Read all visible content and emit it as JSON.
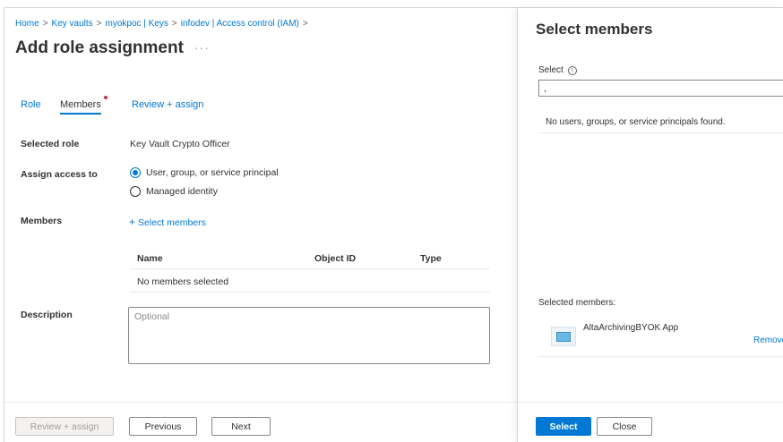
{
  "breadcrumb": {
    "items": [
      "Home",
      "Key vaults",
      "myokpoc | Keys",
      "infodev | Access control (IAM)"
    ],
    "trailing": ">"
  },
  "page": {
    "title": "Add role assignment",
    "more": "···"
  },
  "tabs": [
    {
      "label": "Role"
    },
    {
      "label": "Members"
    },
    {
      "label": "Review + assign"
    }
  ],
  "form": {
    "selected_role_label": "Selected role",
    "selected_role_value": "Key Vault Crypto Officer",
    "assign_access_label": "Assign access to",
    "options": [
      "User, group, or service principal",
      "Managed identity"
    ],
    "members_label": "Members",
    "select_members_link": "Select members",
    "table_headers": [
      "Name",
      "Object ID",
      "Type"
    ],
    "table_empty": "No members selected",
    "description_label": "Description",
    "description_placeholder": "Optional"
  },
  "footer": {
    "review": "Review + assign",
    "previous": "Previous",
    "next": "Next"
  },
  "panel": {
    "title": "Select members",
    "select_label": "Select",
    "search_value": ",",
    "empty_text": "No users, groups, or service principals found.",
    "selected_label": "Selected members:",
    "member_name": "AltaArchivingBYOK App",
    "remove": "Remove",
    "select_button": "Select",
    "close_button": "Close"
  },
  "colors": {
    "accent": "#0078d4",
    "required_dot": "#c4314b"
  },
  "icons": {
    "ellipsis": "more-icon",
    "info": "info-icon",
    "plus": "plus-icon",
    "app": "app-icon"
  }
}
